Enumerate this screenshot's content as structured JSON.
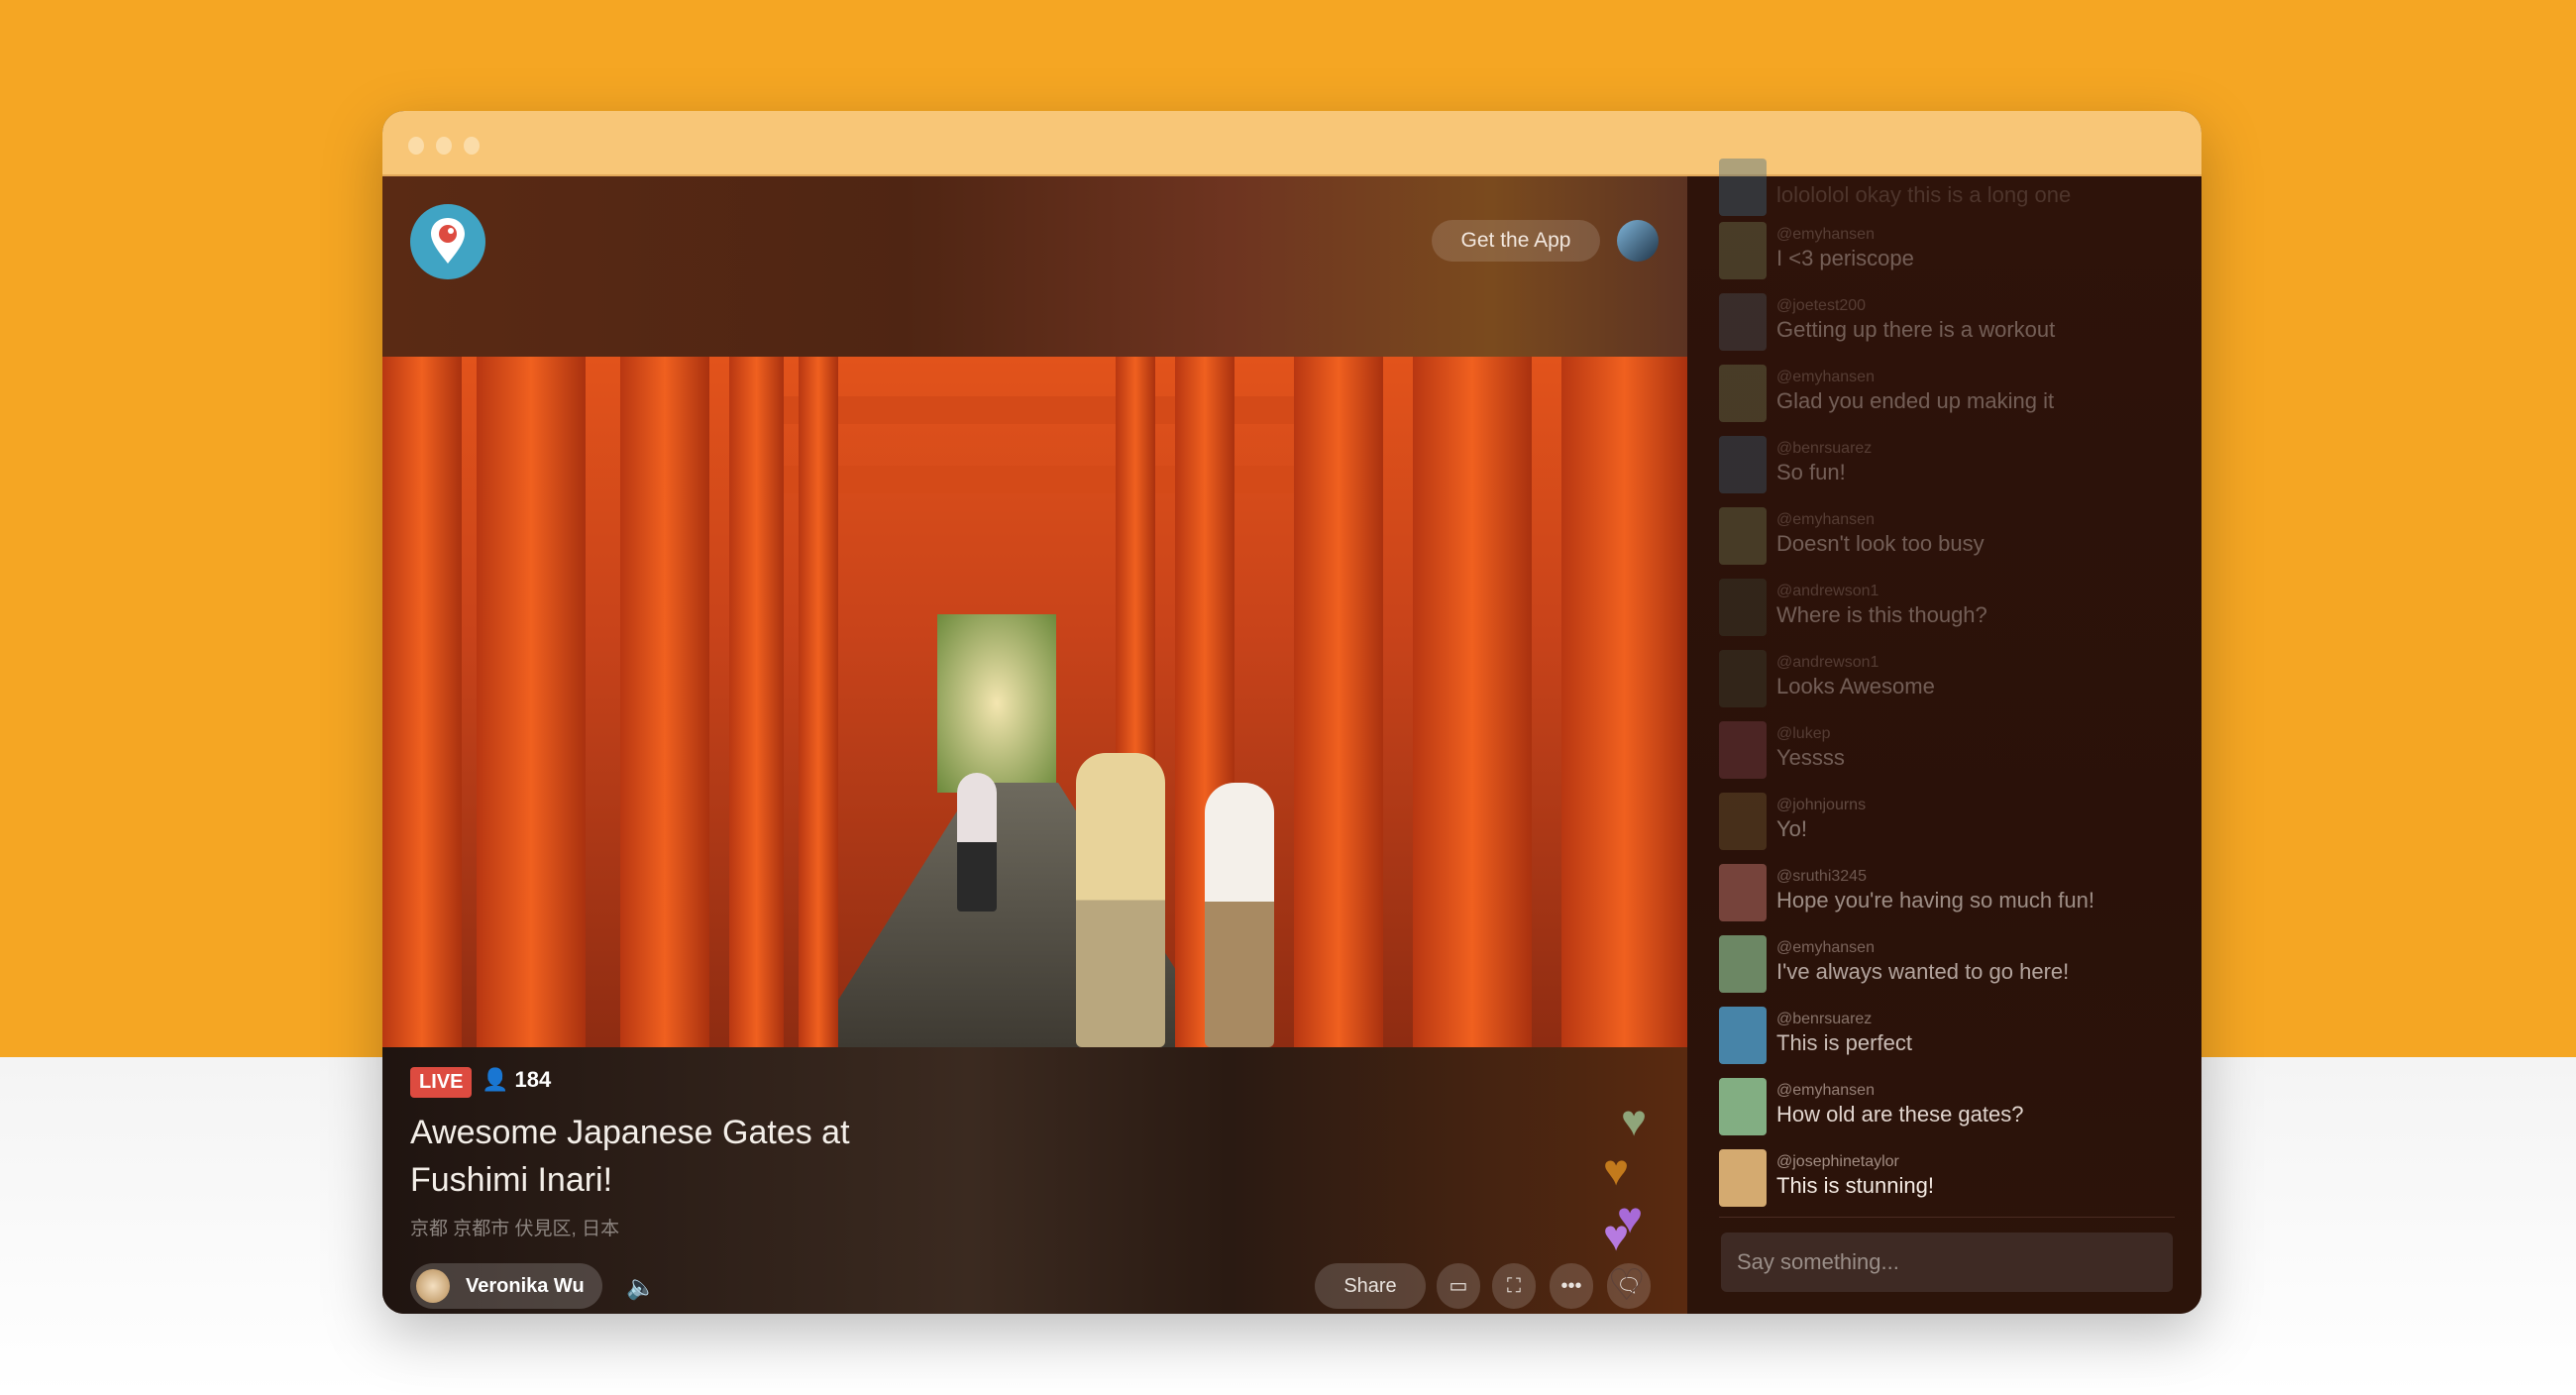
{
  "colors": {
    "background": "#F5A623",
    "titlebar": "#F8C677",
    "live": "#DD4B40",
    "logo": "#40A4C4"
  },
  "header": {
    "get_app": "Get the App"
  },
  "broadcast": {
    "live_label": "LIVE",
    "viewers": "184",
    "title_line1": "Awesome Japanese Gates at",
    "title_line2": "Fushimi Inari!",
    "location": "京都 京都市 伏見区, 日本",
    "host": "Veronika Wu",
    "share": "Share"
  },
  "chat": {
    "partial": "lolololol okay this is a long one",
    "messages": [
      {
        "user": "@emyhansen",
        "text": "I <3 periscope",
        "color": "#7b8a5e"
      },
      {
        "user": "@joetest200",
        "text": "Getting up there is a workout",
        "color": "#4f5e66"
      },
      {
        "user": "@emyhansen",
        "text": "Glad you ended up making it",
        "color": "#7b8a5e"
      },
      {
        "user": "@benrsuarez",
        "text": "So fun!",
        "color": "#3f6880"
      },
      {
        "user": "@emyhansen",
        "text": "Doesn't look too busy",
        "color": "#7b8a5e"
      },
      {
        "user": "@andrewson1",
        "text": "Where is this though?",
        "color": "#3e4a3a"
      },
      {
        "user": "@andrewson1",
        "text": "Looks Awesome",
        "color": "#3e4a3a"
      },
      {
        "user": "@lukep",
        "text": "Yessss",
        "color": "#8a4a5a"
      },
      {
        "user": "@johnjourns",
        "text": "Yo!",
        "color": "#6a5230"
      },
      {
        "user": "@sruthi3245",
        "text": "Hope you're having so much fun!",
        "color": "#b06a62"
      },
      {
        "user": "@emyhansen",
        "text": "I've always wanted to go here!",
        "color": "#8cc090"
      },
      {
        "user": "@benrsuarez",
        "text": "This is perfect",
        "color": "#4fa4d4"
      },
      {
        "user": "@emyhansen",
        "text": "How old are these gates?",
        "color": "#8cc090"
      },
      {
        "user": "@josephinetaylor",
        "text": "This is stunning!",
        "color": "#d4aa70"
      }
    ],
    "placeholder": "Say something..."
  }
}
